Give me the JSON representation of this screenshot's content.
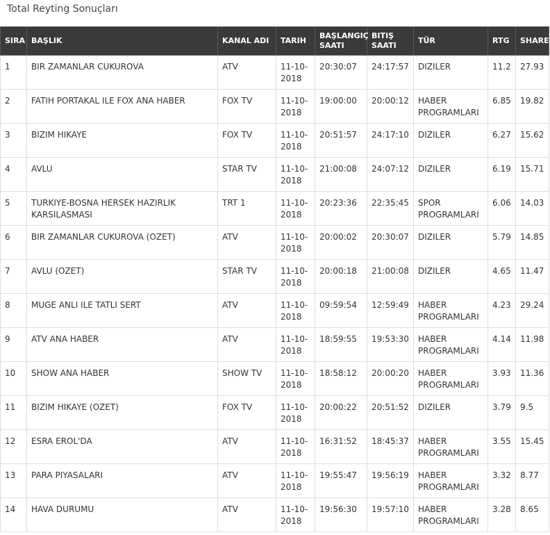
{
  "page": {
    "title": "Total Reyting Sonuçları"
  },
  "table": {
    "headers": {
      "rank": "SIRA",
      "title": "BAŞLIK",
      "channel": "KANAL ADI",
      "date": "TARIH",
      "start": "BAŞLANGIÇ SAATI",
      "end": "BITIŞ SAATI",
      "genre": "TÜR",
      "rtg": "RTG",
      "share": "SHARE"
    },
    "rows": [
      {
        "rank": "1",
        "title": "BIR ZAMANLAR CUKUROVA",
        "channel": "ATV",
        "date": "11-10-2018",
        "start": "20:30:07",
        "end": "24:17:57",
        "genre": "DIZILER",
        "rtg": "11.2",
        "share": "27.93"
      },
      {
        "rank": "2",
        "title": "FATIH PORTAKAL ILE FOX ANA HABER",
        "channel": "FOX TV",
        "date": "11-10-2018",
        "start": "19:00:00",
        "end": "20:00:12",
        "genre": "HABER PROGRAMLARI",
        "rtg": "6.85",
        "share": "19.82"
      },
      {
        "rank": "3",
        "title": "BIZIM HIKAYE",
        "channel": "FOX TV",
        "date": "11-10-2018",
        "start": "20:51:57",
        "end": "24:17:10",
        "genre": "DIZILER",
        "rtg": "6.27",
        "share": "15.62"
      },
      {
        "rank": "4",
        "title": "AVLU",
        "channel": "STAR TV",
        "date": "11-10-2018",
        "start": "21:00:08",
        "end": "24:07:12",
        "genre": "DIZILER",
        "rtg": "6.19",
        "share": "15.71"
      },
      {
        "rank": "5",
        "title": "TURKIYE-BOSNA HERSEK HAZIRLIK KARSILASMASI",
        "channel": "TRT 1",
        "date": "11-10-2018",
        "start": "20:23:36",
        "end": "22:35:45",
        "genre": "SPOR PROGRAMLARI",
        "rtg": "6.06",
        "share": "14.03"
      },
      {
        "rank": "6",
        "title": "BIR ZAMANLAR CUKUROVA (OZET)",
        "channel": "ATV",
        "date": "11-10-2018",
        "start": "20:00:02",
        "end": "20:30:07",
        "genre": "DIZILER",
        "rtg": "5.79",
        "share": "14.85"
      },
      {
        "rank": "7",
        "title": "AVLU (OZET)",
        "channel": "STAR TV",
        "date": "11-10-2018",
        "start": "20:00:18",
        "end": "21:00:08",
        "genre": "DIZILER",
        "rtg": "4.65",
        "share": "11.47"
      },
      {
        "rank": "8",
        "title": "MUGE ANLI ILE TATLI SERT",
        "channel": "ATV",
        "date": "11-10-2018",
        "start": "09:59:54",
        "end": "12:59:49",
        "genre": "HABER PROGRAMLARI",
        "rtg": "4.23",
        "share": "29.24"
      },
      {
        "rank": "9",
        "title": "ATV ANA HABER",
        "channel": "ATV",
        "date": "11-10-2018",
        "start": "18:59:55",
        "end": "19:53:30",
        "genre": "HABER PROGRAMLARI",
        "rtg": "4.14",
        "share": "11.98"
      },
      {
        "rank": "10",
        "title": "SHOW ANA HABER",
        "channel": "SHOW TV",
        "date": "11-10-2018",
        "start": "18:58:12",
        "end": "20:00:20",
        "genre": "HABER PROGRAMLARI",
        "rtg": "3.93",
        "share": "11.36"
      },
      {
        "rank": "11",
        "title": "BIZIM HIKAYE (OZET)",
        "channel": "FOX TV",
        "date": "11-10-2018",
        "start": "20:00:22",
        "end": "20:51:52",
        "genre": "DIZILER",
        "rtg": "3.79",
        "share": "9.5"
      },
      {
        "rank": "12",
        "title": "ESRA EROL'DA",
        "channel": "ATV",
        "date": "11-10-2018",
        "start": "16:31:52",
        "end": "18:45:37",
        "genre": "HABER PROGRAMLARI",
        "rtg": "3.55",
        "share": "15.45"
      },
      {
        "rank": "13",
        "title": "PARA PIYASALARI",
        "channel": "ATV",
        "date": "11-10-2018",
        "start": "19:55:47",
        "end": "19:56:19",
        "genre": "HABER PROGRAMLARI",
        "rtg": "3.32",
        "share": "8.77"
      },
      {
        "rank": "14",
        "title": "HAVA DURUMU",
        "channel": "ATV",
        "date": "11-10-2018",
        "start": "19:56:30",
        "end": "19:57:10",
        "genre": "HABER PROGRAMLARI",
        "rtg": "3.28",
        "share": "8.65"
      }
    ]
  }
}
